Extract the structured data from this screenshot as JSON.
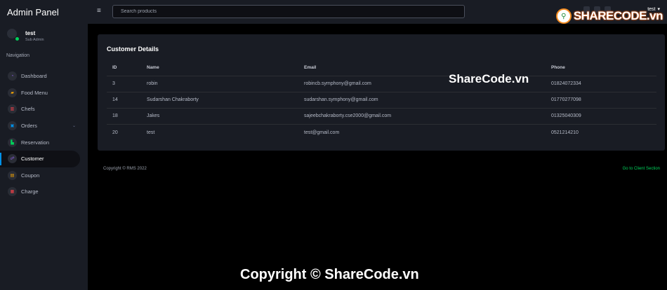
{
  "sidebar": {
    "brand": "Admin Panel",
    "profile": {
      "name": "test",
      "role": "Sub Admin"
    },
    "nav_title": "Navigation",
    "items": [
      {
        "label": "Dashboard",
        "icon": "speedometer-icon",
        "color": "#8f5fe8",
        "glyph": "◔"
      },
      {
        "label": "Food Menu",
        "icon": "food-icon",
        "color": "#ffab00",
        "glyph": "▰"
      },
      {
        "label": "Chefs",
        "icon": "chef-icon",
        "color": "#fc424a",
        "glyph": "▥"
      },
      {
        "label": "Orders",
        "icon": "orders-icon",
        "color": "#0090e7",
        "glyph": "▣"
      },
      {
        "label": "Reservation",
        "icon": "chart-icon",
        "color": "#00d25b",
        "glyph": "▙"
      },
      {
        "label": "Customer",
        "icon": "users-icon",
        "color": "#8f5fe8",
        "glyph": "☍"
      },
      {
        "label": "Coupon",
        "icon": "coupon-icon",
        "color": "#ffab00",
        "glyph": "▤"
      },
      {
        "label": "Charge",
        "icon": "charge-icon",
        "color": "#fc424a",
        "glyph": "▦"
      }
    ],
    "active_index": 5
  },
  "topbar": {
    "search_placeholder": "Search products",
    "user": "test"
  },
  "logo": {
    "text": "SHARECODE.vn"
  },
  "card": {
    "title": "Customer Details",
    "columns": [
      "ID",
      "Name",
      "Email",
      "Phone"
    ],
    "rows": [
      [
        "3",
        "robin",
        "robincb.symphony@gmail.com",
        "01824072334"
      ],
      [
        "14",
        "Sudarshan Chakraborty",
        "sudarshan.symphony@gmail.com",
        "01770277098"
      ],
      [
        "18",
        "Jakes",
        "sajeebchakraborty.cse2000@gmail.com",
        "01325040309"
      ],
      [
        "20",
        "test",
        "test@gmail.com",
        "0521214210"
      ]
    ]
  },
  "watermark_card": "ShareCode.vn",
  "footer": {
    "copyright": "Copyright © RMS 2022",
    "client_link": "Go to Client Section"
  },
  "watermark_bottom": "Copyright © ShareCode.vn"
}
